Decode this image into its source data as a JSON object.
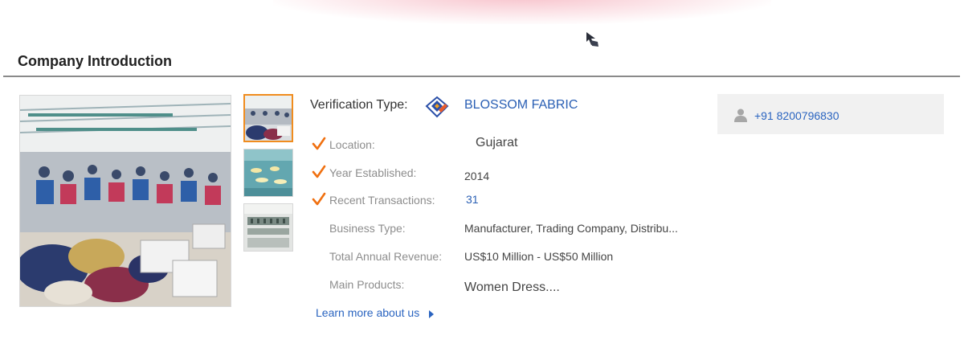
{
  "section": {
    "title": "Company Introduction"
  },
  "gallery": {
    "main_image": "factory-floor-photo",
    "thumbnails": [
      {
        "image": "factory-floor-thumb",
        "active": true
      },
      {
        "image": "showroom-thumb",
        "active": false
      },
      {
        "image": "embroidery-machines-thumb",
        "active": false
      }
    ]
  },
  "verification": {
    "label": "Verification Type:",
    "icon": "verified-supplier-icon",
    "company": "BLOSSOM FABRIC"
  },
  "details": [
    {
      "label": "Location:",
      "value": "Gujarat",
      "checked": true
    },
    {
      "label": "Year Established:",
      "value": "2014",
      "checked": true
    },
    {
      "label": "Recent Transactions:",
      "value": "31",
      "checked": true
    },
    {
      "label": "Business Type:",
      "value": "Manufacturer, Trading Company, Distribu...",
      "checked": false
    },
    {
      "label": "Total Annual Revenue:",
      "value": "US$10 Million - US$50 Million",
      "checked": false
    },
    {
      "label": "Main Products:",
      "value": "Women Dress....",
      "checked": false
    }
  ],
  "learn_more": {
    "label": "Learn more about us"
  },
  "contact": {
    "icon": "person-icon",
    "phone": "+91 8200796830"
  },
  "colors": {
    "link": "#2a64c0",
    "check": "#f07010",
    "active_thumb_border": "#f08c1e",
    "panel_bg": "#f1f1f1"
  }
}
